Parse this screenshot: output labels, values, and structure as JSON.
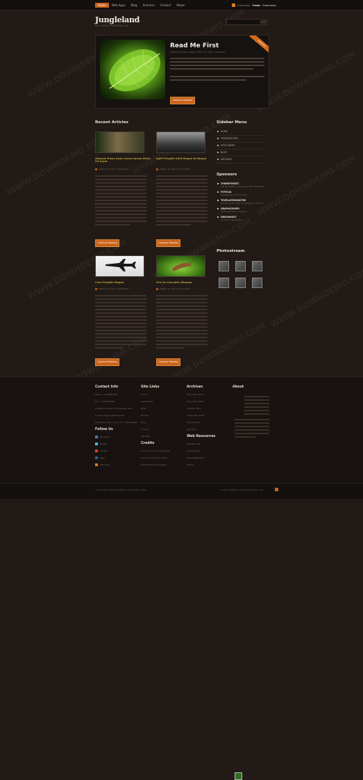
{
  "site": {
    "title": "Jungleland",
    "tagline": "Just another WordPress site"
  },
  "topnav": {
    "items": [
      "Home",
      "Web Apps",
      "Blog",
      "Archives",
      "Contact",
      "About"
    ],
    "rss_label": "Subscribe:",
    "posts_label": "Posts",
    "comments_label": "Comments"
  },
  "search": {
    "placeholder": ""
  },
  "feature": {
    "title": "Read Me First",
    "meta": "Posted by Erwin Aligam | Mar 13, 2009 | Featured",
    "badge": "Featured",
    "button": "Continue Reading"
  },
  "recent": {
    "title": "Recent Articles",
    "articles": [
      {
        "title": "Aliquam Risus Justo Lorem Ipsum Dolor Sit Amet",
        "meta": "Posted: Jan 05 | 3 Comments",
        "button": "Continue Reading"
      },
      {
        "title": "Eget Fringilla Velit Magna At Neque",
        "meta": "Posted: Jan 04 | 2 Comments",
        "button": "Continue Reading"
      },
      {
        "title": "Cras Fringilla Magna",
        "meta": "Posted: Jan 03 | 3 Comments",
        "button": "Continue Reading"
      },
      {
        "title": "Orci Ac Convallis Aliquam",
        "meta": "Posted: Jan 02 | 4 Comments",
        "button": "Continue Reading"
      }
    ]
  },
  "sidebar": {
    "menu_title": "Sidebar Menu",
    "menu": [
      "HOME",
      "TEMPLATE INFO",
      "STYLE DEMO",
      "BLOG",
      "ARCHIVES"
    ],
    "sponsors_title": "Sponsors",
    "sponsors": [
      {
        "name": "THEMEFOREST",
        "desc": "Site Templates, Themes & Web Templates"
      },
      {
        "name": "FOTOLIA",
        "desc": "Royalty free stock photos"
      },
      {
        "name": "TEMPLATEMONSTER",
        "desc": "Delivering the best templates on the net"
      },
      {
        "name": "GRAPHICRIVER",
        "desc": "Awesome Stock Graphics"
      },
      {
        "name": "DREAMHOST",
        "desc": "Premium webhosting"
      }
    ],
    "photostream_title": "Photostream"
  },
  "footer": {
    "contact_title": "Contact Info",
    "contact_phone": "Phone: +1234567891",
    "contact_fax": "Fax: +1234567891",
    "contact_address": "Address: 123 Put Your Address Here",
    "contact_email": "E-mail: me@jungleland.com",
    "contact_site": "Want more info - go to our contact page",
    "follow_title": "Follow Us",
    "follow_items": [
      "Facebook",
      "Twitter",
      "Google",
      "Digg",
      "RSS Feed"
    ],
    "links_title": "Site Links",
    "links": [
      "Home",
      "Style Demo",
      "Blog",
      "Archive",
      "Docs",
      "Contact",
      "Site Map"
    ],
    "credits_title": "Credits",
    "credits": [
      "Round Icons by Icon Builder",
      "Free Icons by Wefunction",
      "Free Photos by Unsplash"
    ],
    "archives_title": "Archives",
    "archives": [
      "December 2012",
      "November 2012",
      "October 2012",
      "September 2012",
      "August 2012",
      "July 2012"
    ],
    "resources_title": "Web Resources",
    "resources": [
      "ThemeForest",
      "GraphicRiver",
      "TemplateMonster",
      "Fotolia"
    ],
    "about_title": "About"
  },
  "bottom": {
    "copyright": "© Copyright 2012 Jungleland. Valid XHTML | CSS",
    "right": "Home | Sitemap | RSS Feed | Back to Top"
  },
  "watermark": "WWW.DOWNDEMO.COM"
}
